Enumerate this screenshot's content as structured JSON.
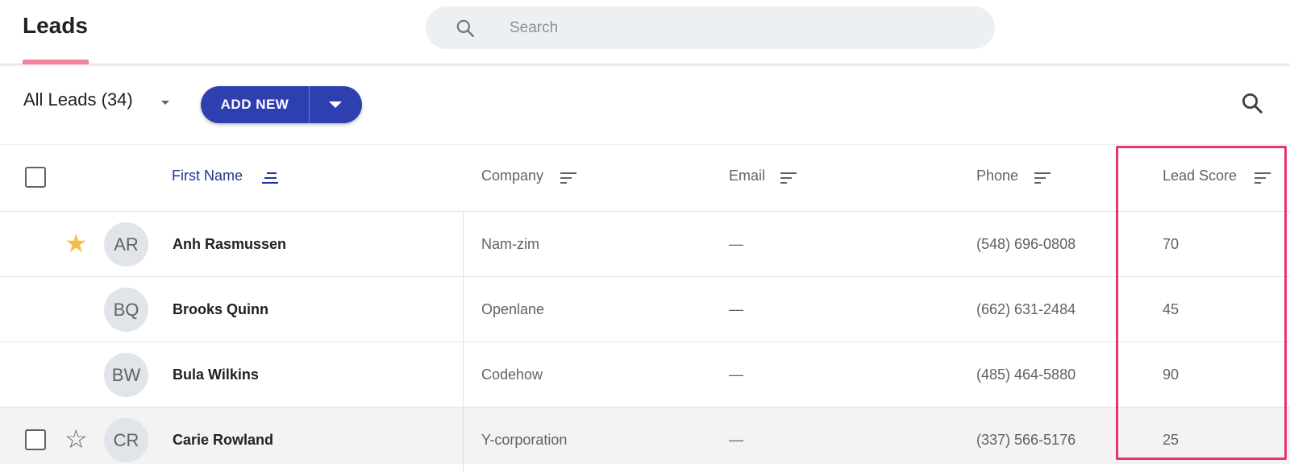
{
  "header": {
    "title": "Leads",
    "search_placeholder": "Search"
  },
  "toolbar": {
    "view_label": "All Leads (34)",
    "add_new_label": "ADD NEW"
  },
  "table": {
    "columns": [
      {
        "label": "First Name",
        "active": true
      },
      {
        "label": "Company"
      },
      {
        "label": "Email"
      },
      {
        "label": "Phone"
      },
      {
        "label": "Lead Score"
      }
    ],
    "rows": [
      {
        "initials": "AR",
        "name": "Anh Rasmussen",
        "company": "Nam-zim",
        "email": "—",
        "phone": "(548) 696-0808",
        "lead_score": "70",
        "starred": true
      },
      {
        "initials": "BQ",
        "name": "Brooks Quinn",
        "company": "Openlane",
        "email": "—",
        "phone": "(662) 631-2484",
        "lead_score": "45",
        "starred": false
      },
      {
        "initials": "BW",
        "name": "Bula Wilkins",
        "company": "Codehow",
        "email": "—",
        "phone": "(485) 464-5880",
        "lead_score": "90",
        "starred": false
      },
      {
        "initials": "CR",
        "name": "Carie Rowland",
        "company": "Y-corporation",
        "email": "—",
        "phone": "(337) 566-5176",
        "lead_score": "25",
        "starred": false,
        "hovered": true
      }
    ]
  },
  "colors": {
    "accent": "#2e3fb0",
    "tab_underline": "#f0829a",
    "highlight_border": "#e8336d",
    "star_filled": "#f2c04a"
  }
}
